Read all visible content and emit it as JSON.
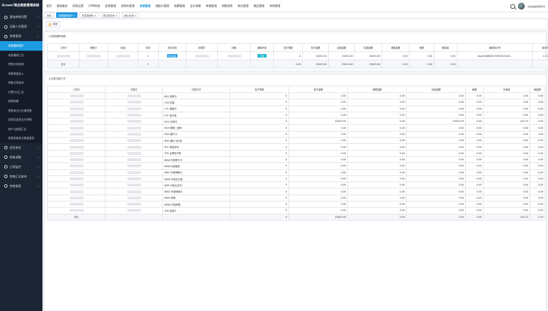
{
  "app": {
    "title": "Ecnen²商业智能管理系统"
  },
  "topnav": [
    {
      "label": "首页",
      "active": false
    },
    {
      "label": "基础服务",
      "active": false
    },
    {
      "label": "招商运营",
      "active": false
    },
    {
      "label": "CRM系统",
      "active": false
    },
    {
      "label": "促销管理",
      "active": false
    },
    {
      "label": "进销存管理",
      "active": false
    },
    {
      "label": "收银管理",
      "active": true
    },
    {
      "label": "储值卡管理",
      "active": false
    },
    {
      "label": "结算管理",
      "active": false
    },
    {
      "label": "会计核算",
      "active": false
    },
    {
      "label": "单据管理",
      "active": false
    },
    {
      "label": "销售报表",
      "active": false
    },
    {
      "label": "物业管理",
      "active": false
    },
    {
      "label": "物品管理",
      "active": false
    },
    {
      "label": "系统管理",
      "active": false
    }
  ],
  "user": {
    "name": "sanglobdmin"
  },
  "sidebar": {
    "groups": [
      {
        "label": "基础参数设置",
        "chev": "›"
      },
      {
        "label": "设备人员管理",
        "chev": "›"
      },
      {
        "label": "销售管理",
        "chev": "⌄"
      }
    ],
    "subitems": [
      {
        "label": "收银缴款维护",
        "active": true
      },
      {
        "label": "收银缴款汇总",
        "active": false
      },
      {
        "label": "销售交易查询",
        "active": false
      },
      {
        "label": "销售数据录入",
        "active": false
      },
      {
        "label": "销售交易查询",
        "active": false
      },
      {
        "label": "付费方式汇总",
        "active": false
      },
      {
        "label": "限期结算",
        "active": false
      },
      {
        "label": "销售商支付分摊明细",
        "active": false
      },
      {
        "label": "收银员退货支付明细",
        "active": false
      },
      {
        "label": "商户注册情汇总",
        "active": false
      },
      {
        "label": "联营销售营业数据报表",
        "active": false
      }
    ],
    "groups2": [
      {
        "label": "退货审定",
        "chev": "›"
      },
      {
        "label": "销售调整",
        "chev": "›"
      },
      {
        "label": "日常监控",
        "chev": "›"
      },
      {
        "label": "销售汇总查询",
        "chev": "›"
      },
      {
        "label": "销售报表",
        "chev": "›"
      }
    ]
  },
  "tags": [
    {
      "label": "首页",
      "active": false
    },
    {
      "label": "收银缴款维护 ×",
      "active": true
    },
    {
      "label": "商务报销单 ×",
      "active": false
    },
    {
      "label": "提付款查询 ×",
      "active": false
    },
    {
      "label": "营业查询 ×",
      "active": false
    }
  ],
  "toolbar": {
    "back_label": "返回"
  },
  "panel1": {
    "title": "◎收银缴款明细",
    "headers": [
      "工作日",
      "销售日",
      "班组",
      "班次",
      "班次状态",
      "收银员",
      "设备",
      "缴款状态",
      "支付笔数",
      "支付金额",
      "应缴金额",
      "实缴金额",
      "调整金额",
      "差额",
      "备用金",
      "缴款批次号",
      "版本号"
    ],
    "row": {
      "shift": "1",
      "shift_status": "营业结束",
      "pay_status": "已缴",
      "count": "4",
      "pay": "31000.00",
      "due": "31000.00",
      "paid": "31000.00",
      "adjust": "0.00",
      "diff": "0.00",
      "reserve": "0.00",
      "batch": "day0ce8682025052510140...",
      "version": "1.0.7"
    },
    "total": {
      "label": "总计",
      "shift": "1",
      "count": "4.00",
      "pay": "31000.00",
      "due": "31000.00",
      "paid": "31000.00",
      "adjust": "0.00",
      "diff": "0.00",
      "reserve": "0.00"
    }
  },
  "panel2": {
    "title": "◎交易付款方式",
    "headers": [
      "工作日",
      "交易日",
      "付款方式",
      "支付笔数",
      "支付金额",
      "调整金额",
      "实缴金额",
      "差额",
      "手续费",
      "佣金额"
    ],
    "rows": [
      {
        "method": "BSS-资源卡",
        "count": "0",
        "pay": "0.00",
        "adjust": "0.00",
        "paid": "0.00",
        "diff": "0.00",
        "fee": "0.00",
        "comm": "0.00"
      },
      {
        "method": "CAS-现金",
        "count": "0",
        "pay": "0.00",
        "adjust": "0.00",
        "paid": "0.00",
        "diff": "0.00",
        "fee": "0.00",
        "comm": "0.00"
      },
      {
        "method": "CTC-储值卡",
        "count": "0",
        "pay": "0.00",
        "adjust": "0.00",
        "paid": "0.00",
        "diff": "0.00",
        "fee": "0.00",
        "comm": "0.00"
      },
      {
        "method": "ETC-电子券",
        "count": "0",
        "pay": "0.00",
        "adjust": "0.00",
        "paid": "0.00",
        "diff": "0.00",
        "fee": "0.00",
        "comm": "0.00"
      },
      {
        "method": "M15-扫码付",
        "count": "4",
        "pay": "31000.00",
        "adjust": "0.00",
        "paid": "31000.00",
        "diff": "0.00",
        "fee": "124.23",
        "comm": "0.00"
      },
      {
        "method": "M29-微购二维码",
        "count": "0",
        "pay": "0.00",
        "adjust": "0.00",
        "paid": "0.00",
        "diff": "0.00",
        "fee": "0.00",
        "comm": "0.00"
      },
      {
        "method": "MXX-银行卡",
        "count": "0",
        "pay": "0.00",
        "adjust": "0.00",
        "paid": "0.00",
        "diff": "0.00",
        "fee": "0.00",
        "comm": "0.00"
      },
      {
        "method": "RMS-银行卡补录",
        "count": "0",
        "pay": "0.00",
        "adjust": "0.00",
        "paid": "0.00",
        "diff": "0.00",
        "fee": "0.00",
        "comm": "0.00"
      },
      {
        "method": "RTC-现金折扣",
        "count": "0",
        "pay": "0.00",
        "adjust": "0.00",
        "paid": "0.00",
        "diff": "0.00",
        "fee": "0.00",
        "comm": "0.00"
      },
      {
        "method": "STA-企联电子券",
        "count": "0",
        "pay": "0.00",
        "adjust": "0.00",
        "paid": "0.00",
        "diff": "0.00",
        "fee": "0.00",
        "comm": "0.00"
      },
      {
        "method": "WBA-外部银行卡",
        "count": "0",
        "pay": "0.00",
        "adjust": "0.00",
        "paid": "0.00",
        "diff": "0.00",
        "fee": "0.00",
        "comm": "0.00"
      },
      {
        "method": "WBB-外部微信",
        "count": "0",
        "pay": "0.00",
        "adjust": "0.00",
        "paid": "0.00",
        "diff": "0.00",
        "fee": "0.00",
        "comm": "0.00"
      },
      {
        "method": "WBC-外部储值卡",
        "count": "0",
        "pay": "0.00",
        "adjust": "0.00",
        "paid": "0.00",
        "diff": "0.00",
        "fee": "0.00",
        "comm": "0.00"
      },
      {
        "method": "WBD-外部支付宝",
        "count": "0",
        "pay": "0.00",
        "adjust": "0.00",
        "paid": "0.00",
        "diff": "0.00",
        "fee": "0.00",
        "comm": "0.00"
      },
      {
        "method": "WBF-外部云闪付",
        "count": "0",
        "pay": "0.00",
        "adjust": "0.00",
        "paid": "0.00",
        "diff": "0.00",
        "fee": "0.00",
        "comm": "0.00"
      },
      {
        "method": "WBG-外部储值卡",
        "count": "0",
        "pay": "0.00",
        "adjust": "0.00",
        "paid": "0.00",
        "diff": "0.00",
        "fee": "0.00",
        "comm": "0.00"
      },
      {
        "method": "WBH-转账",
        "count": "0",
        "pay": "0.00",
        "adjust": "0.00",
        "paid": "0.00",
        "diff": "0.00",
        "fee": "0.00",
        "comm": "0.00"
      },
      {
        "method": "WBW-外部转账",
        "count": "0",
        "pay": "0.00",
        "adjust": "0.00",
        "paid": "0.00",
        "diff": "0.00",
        "fee": "0.00",
        "comm": "0.00"
      },
      {
        "method": "XYK-信用卡",
        "count": "0",
        "pay": "0.00",
        "adjust": "0.00",
        "paid": "0.00",
        "diff": "0.00",
        "fee": "0.00",
        "comm": "0.00"
      }
    ],
    "total": {
      "label": "总计",
      "count": "4",
      "pay": "31000.00",
      "adjust": "0.00",
      "paid": "0.00",
      "diff": "0.00",
      "fee": "124.23",
      "comm": "0.00"
    }
  }
}
